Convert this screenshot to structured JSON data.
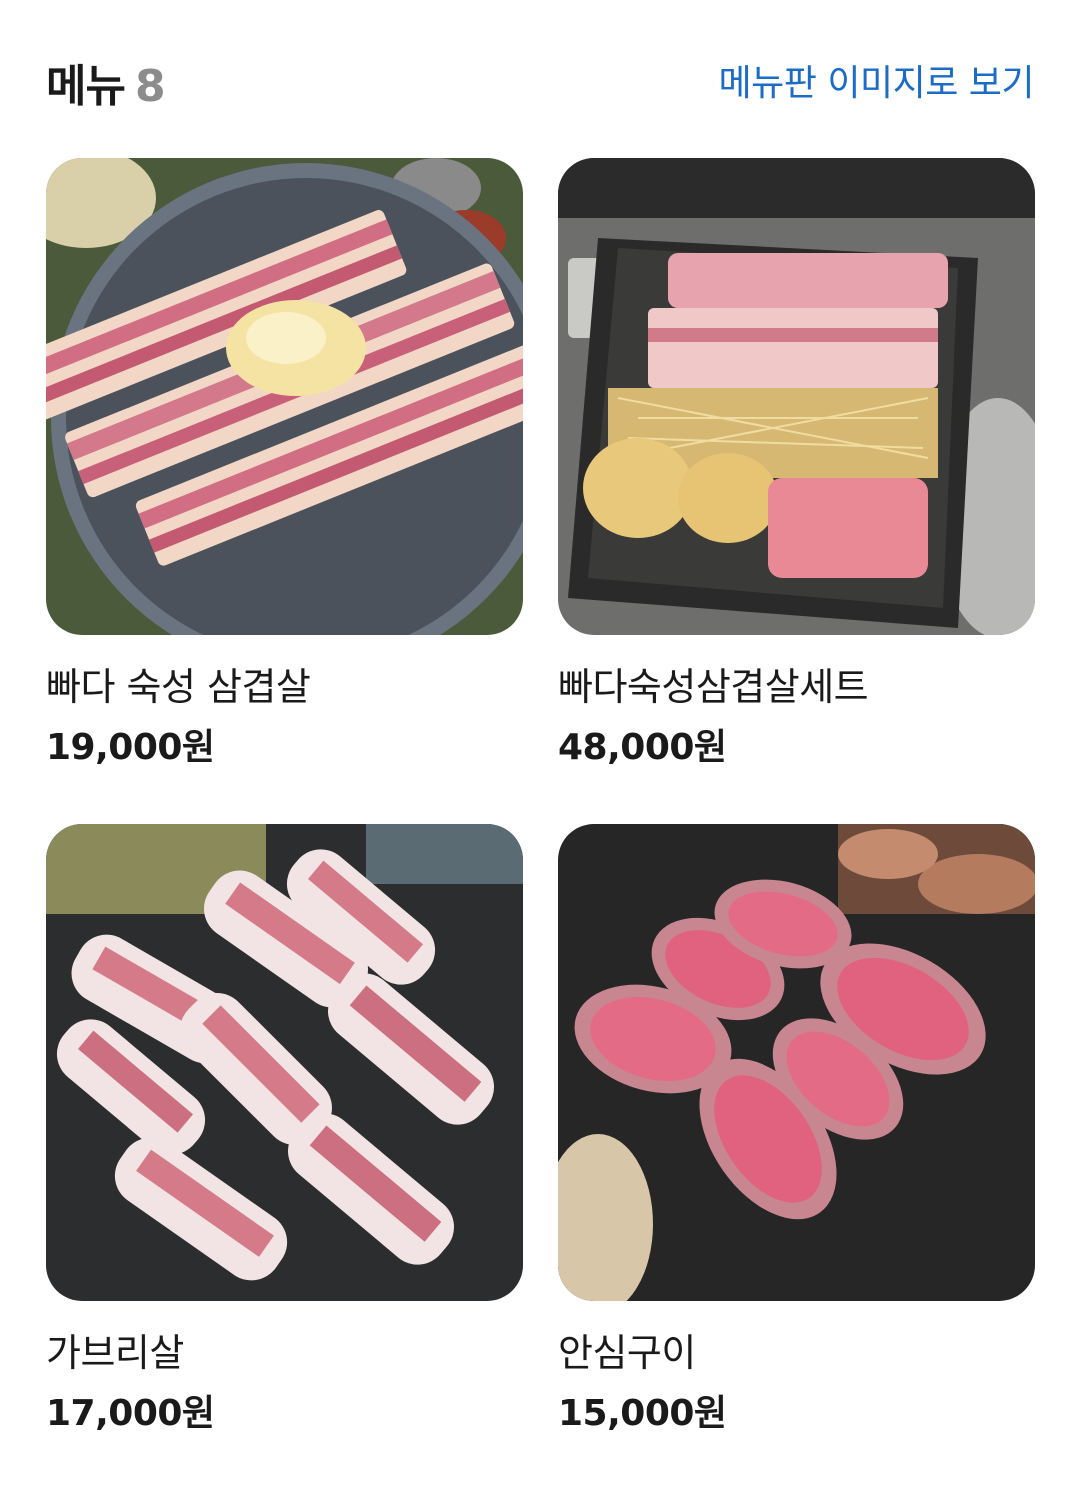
{
  "header": {
    "title": "메뉴",
    "count": "8",
    "menu_board_link": "메뉴판 이미지로 보기"
  },
  "menu_items": [
    {
      "name": "빠다 숙성 삼겹살",
      "price": "19,000원",
      "image": "pork-belly-strips-photo"
    },
    {
      "name": "빠다숙성삼겹살세트",
      "price": "48,000원",
      "image": "pork-set-cast-iron-tray-photo"
    },
    {
      "name": "가브리살",
      "price": "17,000원",
      "image": "pork-jowl-grill-photo"
    },
    {
      "name": "안심구이",
      "price": "15,000원",
      "image": "tenderloin-grill-photo"
    }
  ],
  "colors": {
    "link": "#1a6cc7",
    "count": "#8c8c8c",
    "text": "#1a1a1a"
  }
}
